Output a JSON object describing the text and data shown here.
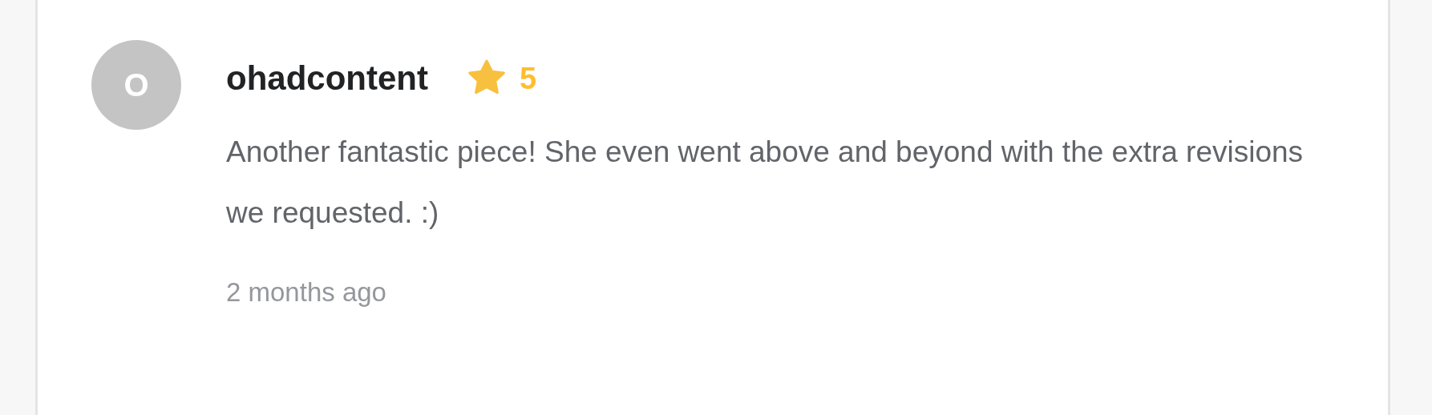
{
  "review": {
    "avatar_letter": "O",
    "username": "ohadcontent",
    "rating": "5",
    "text": "Another fantastic piece! She even went above and beyond with the extra revisions we requested. :)",
    "time": "2 months ago"
  }
}
